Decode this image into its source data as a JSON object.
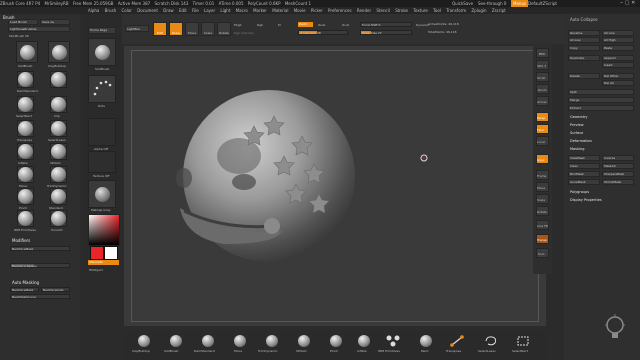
{
  "titlebar": {
    "items": [
      "ZBrush Core 4R7 P4",
      "MrSmileyRB",
      "Free Mem 25.059GB",
      "Active Mem 387",
      "Scratch Disk 143",
      "Timer 0.01",
      "ATime 0.005",
      "PolyCount 0.6KP",
      "MeshCount 1"
    ],
    "quicksave": "QuickSave",
    "seethrough": "See-through  0",
    "menus": "Menus",
    "defaultscript": "DefaultZScript"
  },
  "menubar": {
    "items": [
      "Alpha",
      "Brush",
      "Color",
      "Document",
      "Draw",
      "Edit",
      "File",
      "Layer",
      "Light",
      "Macro",
      "Marker",
      "Material",
      "Movie",
      "Picker",
      "Preferences",
      "Render",
      "Stencil",
      "Stroke",
      "Texture",
      "Tool",
      "Transform",
      "Zplugin",
      "Zscript"
    ]
  },
  "left_palette": {
    "title": "Brush",
    "load_brush": "Load Brush",
    "save_as": "Save As",
    "lightbox": "Lightbox▸Brushes",
    "current_brush": "SkinBrush 26",
    "brushes": [
      "SlotBrush",
      "ClayBuildup",
      "DamStandard",
      "SelectRect",
      "Clip",
      "Transpose",
      "SelectLasso",
      "Inflate",
      "hPolish",
      "Move",
      "TrimDynamic",
      "Pinch",
      "Standard",
      "IMM Primitives",
      "Smooth",
      "Standard",
      "ClipCurve",
      "Move",
      "SelectRect",
      "ZModeler"
    ],
    "modifiers_header": "Modifiers",
    "modifier_rows": [
      "BackfaceMask",
      "Backface Radius"
    ],
    "automasking_header": "Auto Masking",
    "automasking_rows": [
      "BackfaceMask",
      "BackfaceAuto",
      "BackMaskCurve"
    ]
  },
  "brush_column": {
    "home_page": "Home Page",
    "lightbox": "LightBox",
    "items": [
      "SlotBrush",
      "Dots",
      "Alpha Off",
      "Texture Off",
      "MatCap Gray"
    ],
    "switch": "Switch",
    "main_color": "#e8262a",
    "secondary_color": "#ffffff",
    "gradient_label": "Gradient",
    "alternate": "Alternate",
    "fill_object": "FillObject"
  },
  "top_shelf": {
    "edit": "Edit",
    "draw": "Draw",
    "move": "Move",
    "scale": "Scale",
    "rotate": "Rotate",
    "mrgb": "Mrgb",
    "rgb": "Rgb",
    "m": "M",
    "zadd": "Zadd",
    "zsub": "Zsub",
    "zcut": "Zcut",
    "rgb_intensity": "Rgb Intensity",
    "z_intensity": "Z Intensity 38",
    "focal_shift": "Focal Shift 0",
    "draw_size": "Draw Size 27",
    "dynamic": "Dynamic",
    "active_points": "ActivePoints: 46,118",
    "total_points": "TotalPoints: 46,118"
  },
  "right_shelf": {
    "buttons": [
      "BPR",
      "SPix 3",
      "Scroll",
      "Zoom",
      "Actual",
      "AAHalf",
      "Persp",
      "Floor",
      "Local",
      "LSym",
      "Gxyz",
      "Frame",
      "Move",
      "Scale",
      "Rotate",
      "Line Fill",
      "PolyF",
      "Transp",
      "Ghost",
      "Solo",
      "Xpose"
    ]
  },
  "right_palette": {
    "auto_collapse": "Auto Collapse",
    "subtool_buttons": [
      [
        "Rename",
        "All Low"
      ],
      [
        "All Low",
        "All High"
      ],
      [
        "Copy",
        "Paste"
      ],
      [
        "Duplicate",
        "Append"
      ],
      [
        "",
        "Insert"
      ],
      [
        "Delete",
        "Del Other"
      ],
      [
        "",
        "Del All"
      ]
    ],
    "split": "Split",
    "merge": "Merge",
    "extract": "Extract",
    "sections": [
      "Geometry",
      "Preview",
      "Surface",
      "Deformation",
      "Masking"
    ],
    "mask_rows": [
      [
        "ViewMask",
        "Inverse"
      ],
      [
        "Clear",
        "MaskAll"
      ],
      [
        "BlurMask",
        "SharpenMask"
      ],
      [
        "GrowMask",
        "ShrinkMask"
      ]
    ],
    "polygroups": "Polygroups",
    "display_properties": "Display Properties"
  },
  "bottom_shelf": {
    "brushes": [
      "ClayBuildup",
      "SlotBrush",
      "DamStandard",
      "Move",
      "TrimDynamic",
      "hPolish",
      "Pinch",
      "Inflate",
      "IMM Primitives",
      "Paint",
      "Transpose",
      "SelectLasso",
      "SelectRect"
    ]
  },
  "colors": {
    "accent": "#e98a15",
    "canvas": "#3a3a3a",
    "panel": "#2f2f2f"
  }
}
